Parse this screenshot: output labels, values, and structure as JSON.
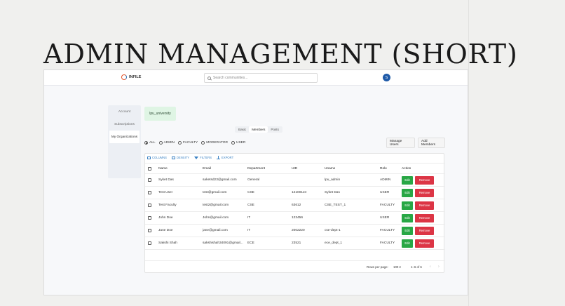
{
  "slide": {
    "title": "ADMIN MANAGEMENT (SHORT)"
  },
  "topbar": {
    "logo_text": "INFILE",
    "search_placeholder": "Search communities...",
    "avatar_initial": "S"
  },
  "sidebar": {
    "items": [
      {
        "label": "Account",
        "active": false
      },
      {
        "label": "Subscriptions",
        "active": false
      },
      {
        "label": "My Organizations",
        "active": true
      }
    ]
  },
  "organization": {
    "name": "lpu_university"
  },
  "tabs": [
    {
      "label": "Basic",
      "active": false
    },
    {
      "label": "Members",
      "active": true
    },
    {
      "label": "Posts",
      "active": false
    }
  ],
  "role_filter": {
    "options": [
      "ALL",
      "ADMIN",
      "FACULTY",
      "MODERATOR",
      "USER"
    ],
    "selected": "ALL"
  },
  "buttons": {
    "manage_users": "Manage Users",
    "add_members": "Add Members"
  },
  "grid_toolbar": {
    "columns": "COLUMNS",
    "density": "DENSITY",
    "filters": "FILTERS",
    "export": "EXPORT"
  },
  "table": {
    "headers": {
      "name": "Name",
      "email": "Email",
      "department": "Department",
      "uid": "UID",
      "uname": "Uname",
      "role": "Role",
      "action": "Action"
    },
    "rows": [
      {
        "name": "Syket Das",
        "email": "saketsd23@gmail.com",
        "department": "General",
        "uid": "",
        "uname": "lpu_admin",
        "role": "ADMIN"
      },
      {
        "name": "Test User",
        "email": "test@gmail.com",
        "department": "CSE",
        "uid": "12100124",
        "uname": "Syket Das",
        "role": "USER"
      },
      {
        "name": "Test Faculty",
        "email": "test2@gmail.com",
        "department": "CSE",
        "uid": "63612",
        "uname": "CSE_TEST_1",
        "role": "FACULTY"
      },
      {
        "name": "John Doe",
        "email": "John@gmail.com",
        "department": "IT",
        "uid": "123456",
        "uname": "",
        "role": "USER"
      },
      {
        "name": "Jane Doe",
        "email": "jane@gmail.com",
        "department": "IT",
        "uid": "2002220",
        "uname": "cse-dept-1",
        "role": "FACULTY"
      },
      {
        "name": "Sakshi Shah",
        "email": "sakshishah34091@gmail....",
        "department": "ECE",
        "uid": "23521",
        "uname": "ece_dept_1",
        "role": "FACULTY"
      }
    ],
    "edit_label": "Edit",
    "remove_label": "Remove"
  },
  "pagination": {
    "rows_per_page_label": "Rows per page:",
    "rows_per_page": "100",
    "range": "1–6 of 6",
    "prev": "‹",
    "next": "›"
  },
  "colors": {
    "edit": "#28a745",
    "remove": "#dc3545",
    "org_chip": "#dff5e4",
    "accent": "#3b82c4",
    "avatar": "#1e5aa8"
  }
}
